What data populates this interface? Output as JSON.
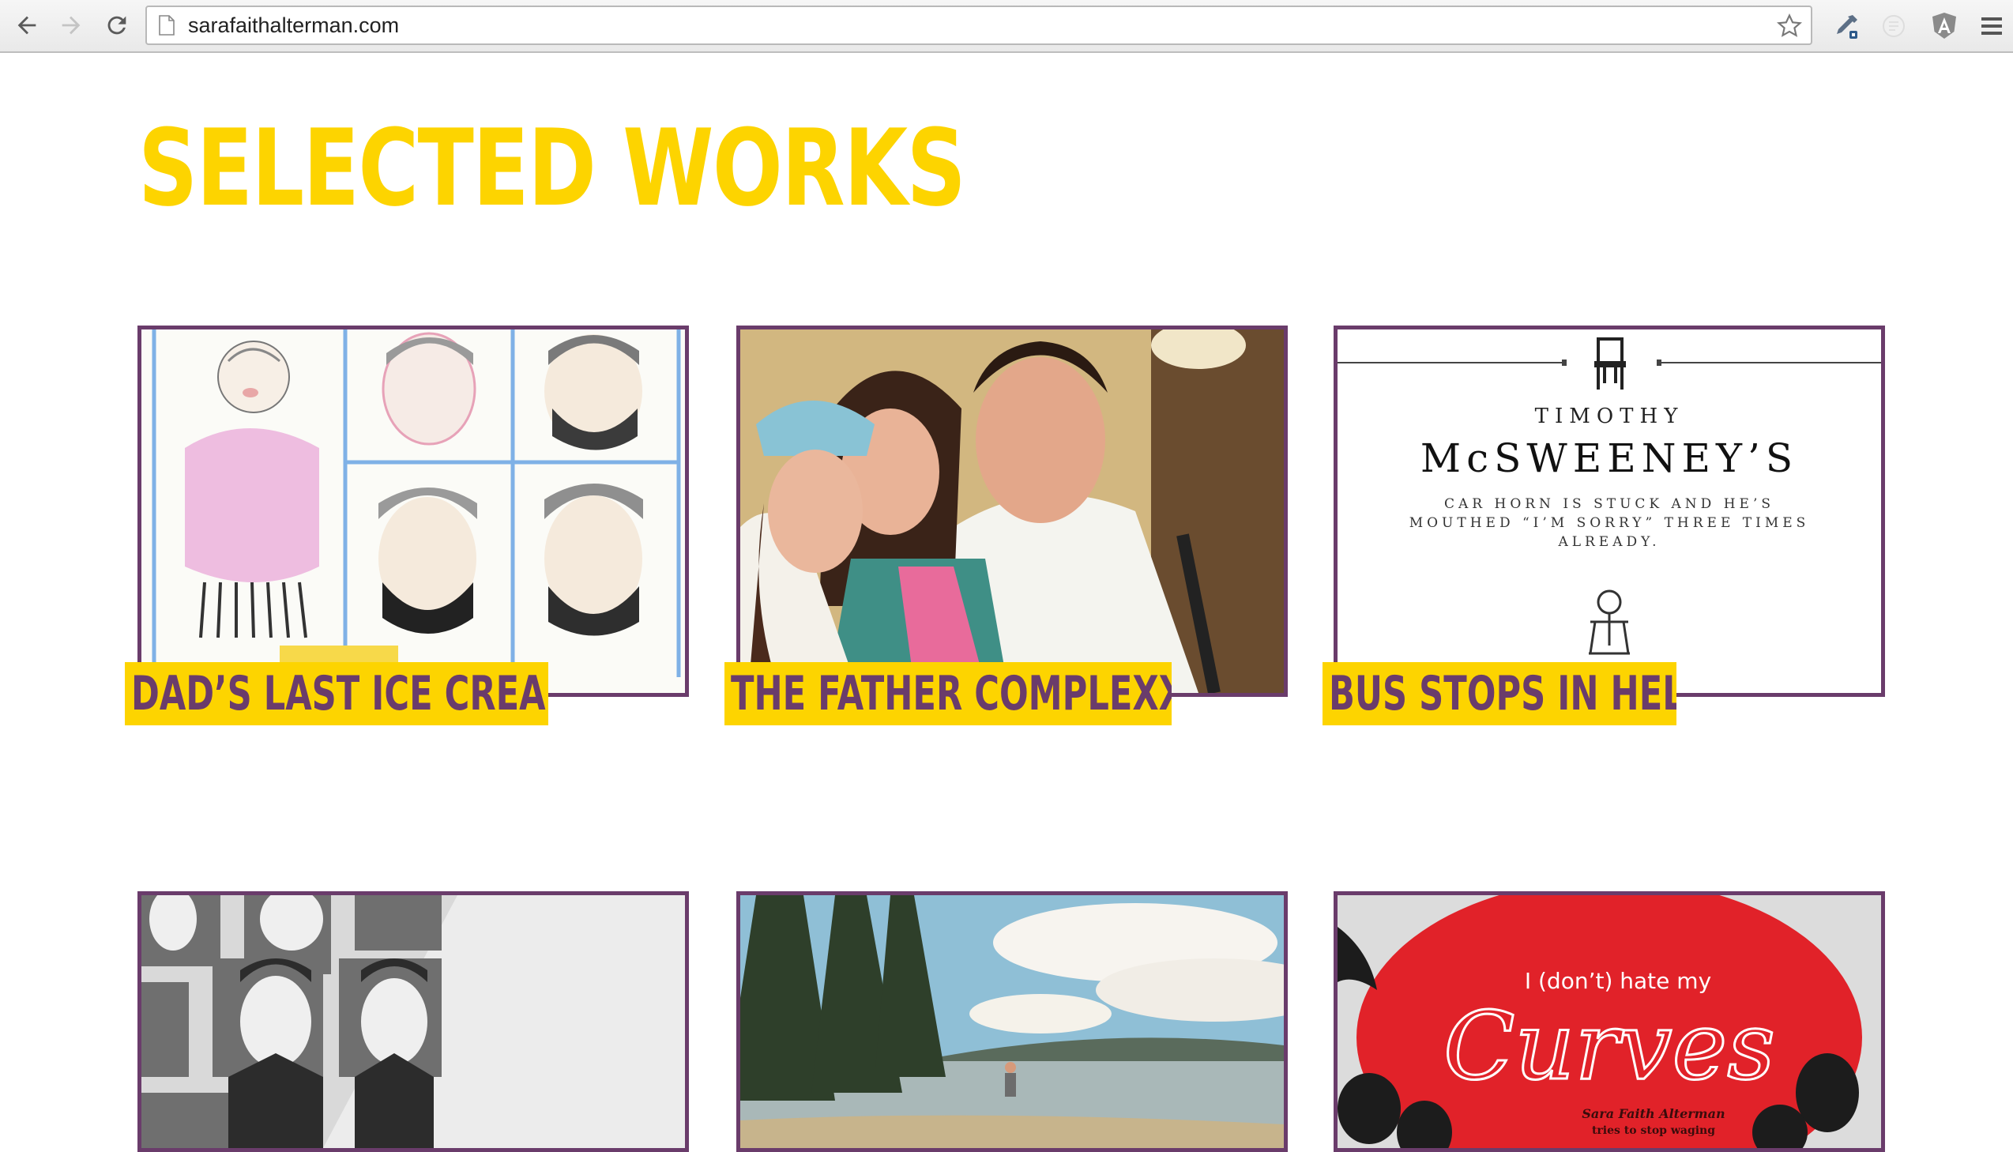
{
  "browser": {
    "url": "sarafaithalterman.com"
  },
  "page": {
    "title": "SELECTED WORKS"
  },
  "works": [
    {
      "title": "DAD’S LAST ICE CREAM"
    },
    {
      "title": "THE FATHER COMPLEXXX"
    },
    {
      "title": "BUS STOPS IN HELL"
    },
    {
      "title": ""
    },
    {
      "title": ""
    },
    {
      "title": ""
    }
  ],
  "mcsweeneys": {
    "line1": "TIMOTHY",
    "line2": "McSWEENEY’S",
    "line3": "CAR HORN IS STUCK AND HE’S",
    "line4": "MOUTHED “I’M SORRY” THREE TIMES",
    "line5": "ALREADY."
  },
  "curves": {
    "line1": "I (don’t) hate my",
    "line2": "Curves",
    "author": "Sara Faith Alterman",
    "subtitle": "tries to stop waging"
  },
  "colors": {
    "accent_yellow": "#fdd400",
    "accent_purple": "#6a3c6b"
  }
}
